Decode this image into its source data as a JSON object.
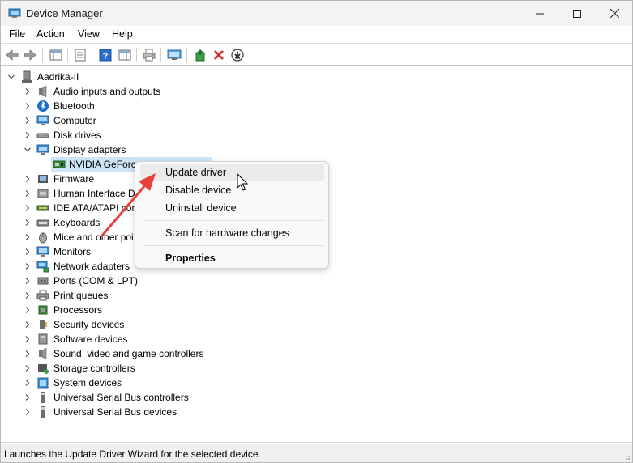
{
  "window": {
    "title": "Device Manager"
  },
  "menu": [
    "File",
    "Action",
    "View",
    "Help"
  ],
  "toolbar": {
    "buttons": [
      "back-icon",
      "forward-icon",
      "console-tree-icon",
      "properties-icon",
      "help-icon",
      "action-pane-icon",
      "print-icon",
      "scan-hardware-icon",
      "update-driver-icon",
      "uninstall-icon",
      "download-icon"
    ]
  },
  "tree": {
    "root": "Aadrika-II",
    "items": [
      {
        "label": "Audio inputs and outputs",
        "icon": "speaker-icon"
      },
      {
        "label": "Bluetooth",
        "icon": "bluetooth-icon"
      },
      {
        "label": "Computer",
        "icon": "computer-icon"
      },
      {
        "label": "Disk drives",
        "icon": "disk-drive-icon"
      },
      {
        "label": "Display adapters",
        "icon": "display-adapter-icon",
        "expanded": true
      },
      {
        "label": "Firmware",
        "icon": "firmware-icon"
      },
      {
        "label": "Human Interface D",
        "icon": "hid-icon"
      },
      {
        "label": "IDE ATA/ATAPI cont",
        "icon": "ide-controller-icon"
      },
      {
        "label": "Keyboards",
        "icon": "keyboard-icon"
      },
      {
        "label": "Mice and other poi",
        "icon": "mouse-icon"
      },
      {
        "label": "Monitors",
        "icon": "monitor-icon"
      },
      {
        "label": "Network adapters",
        "icon": "network-adapter-icon"
      },
      {
        "label": "Ports (COM & LPT)",
        "icon": "port-icon"
      },
      {
        "label": "Print queues",
        "icon": "printer-icon"
      },
      {
        "label": "Processors",
        "icon": "processor-icon"
      },
      {
        "label": "Security devices",
        "icon": "security-device-icon"
      },
      {
        "label": "Software devices",
        "icon": "software-device-icon"
      },
      {
        "label": "Sound, video and game controllers",
        "icon": "sound-icon"
      },
      {
        "label": "Storage controllers",
        "icon": "storage-controller-icon"
      },
      {
        "label": "System devices",
        "icon": "system-device-icon"
      },
      {
        "label": "Universal Serial Bus controllers",
        "icon": "usb-icon"
      },
      {
        "label": "Universal Serial Bus devices",
        "icon": "usb-device-icon"
      }
    ],
    "child_selected": "NVIDIA GeForce"
  },
  "context_menu": {
    "items": [
      "Update driver",
      "Disable device",
      "Uninstall device"
    ],
    "scan": "Scan for hardware changes",
    "properties": "Properties"
  },
  "status": {
    "text": "Launches the Update Driver Wizard for the selected device."
  },
  "colors": {
    "selection": "#cce4f7",
    "arrow": "#e8413c",
    "menu_hover": "#ebebeb"
  }
}
